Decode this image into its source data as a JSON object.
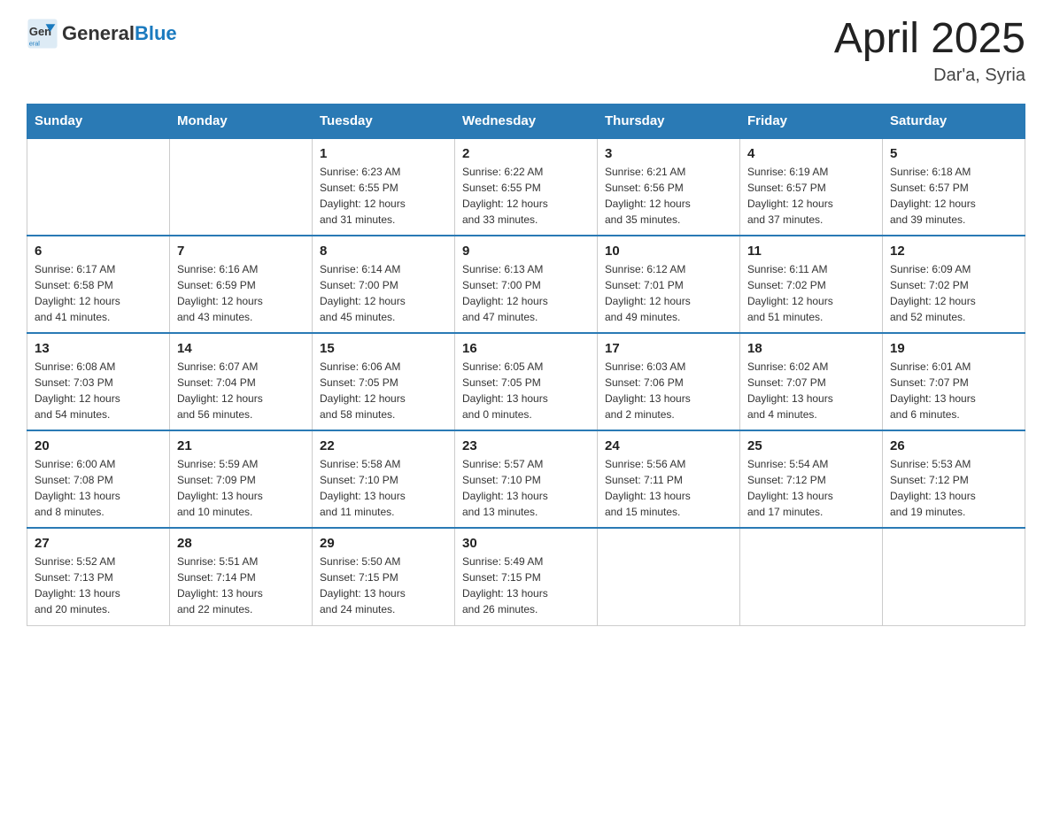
{
  "header": {
    "logo_text_general": "General",
    "logo_text_blue": "Blue",
    "month_title": "April 2025",
    "location": "Dar'a, Syria"
  },
  "days_of_week": [
    "Sunday",
    "Monday",
    "Tuesday",
    "Wednesday",
    "Thursday",
    "Friday",
    "Saturday"
  ],
  "weeks": [
    [
      {
        "day": "",
        "info": ""
      },
      {
        "day": "",
        "info": ""
      },
      {
        "day": "1",
        "info": "Sunrise: 6:23 AM\nSunset: 6:55 PM\nDaylight: 12 hours\nand 31 minutes."
      },
      {
        "day": "2",
        "info": "Sunrise: 6:22 AM\nSunset: 6:55 PM\nDaylight: 12 hours\nand 33 minutes."
      },
      {
        "day": "3",
        "info": "Sunrise: 6:21 AM\nSunset: 6:56 PM\nDaylight: 12 hours\nand 35 minutes."
      },
      {
        "day": "4",
        "info": "Sunrise: 6:19 AM\nSunset: 6:57 PM\nDaylight: 12 hours\nand 37 minutes."
      },
      {
        "day": "5",
        "info": "Sunrise: 6:18 AM\nSunset: 6:57 PM\nDaylight: 12 hours\nand 39 minutes."
      }
    ],
    [
      {
        "day": "6",
        "info": "Sunrise: 6:17 AM\nSunset: 6:58 PM\nDaylight: 12 hours\nand 41 minutes."
      },
      {
        "day": "7",
        "info": "Sunrise: 6:16 AM\nSunset: 6:59 PM\nDaylight: 12 hours\nand 43 minutes."
      },
      {
        "day": "8",
        "info": "Sunrise: 6:14 AM\nSunset: 7:00 PM\nDaylight: 12 hours\nand 45 minutes."
      },
      {
        "day": "9",
        "info": "Sunrise: 6:13 AM\nSunset: 7:00 PM\nDaylight: 12 hours\nand 47 minutes."
      },
      {
        "day": "10",
        "info": "Sunrise: 6:12 AM\nSunset: 7:01 PM\nDaylight: 12 hours\nand 49 minutes."
      },
      {
        "day": "11",
        "info": "Sunrise: 6:11 AM\nSunset: 7:02 PM\nDaylight: 12 hours\nand 51 minutes."
      },
      {
        "day": "12",
        "info": "Sunrise: 6:09 AM\nSunset: 7:02 PM\nDaylight: 12 hours\nand 52 minutes."
      }
    ],
    [
      {
        "day": "13",
        "info": "Sunrise: 6:08 AM\nSunset: 7:03 PM\nDaylight: 12 hours\nand 54 minutes."
      },
      {
        "day": "14",
        "info": "Sunrise: 6:07 AM\nSunset: 7:04 PM\nDaylight: 12 hours\nand 56 minutes."
      },
      {
        "day": "15",
        "info": "Sunrise: 6:06 AM\nSunset: 7:05 PM\nDaylight: 12 hours\nand 58 minutes."
      },
      {
        "day": "16",
        "info": "Sunrise: 6:05 AM\nSunset: 7:05 PM\nDaylight: 13 hours\nand 0 minutes."
      },
      {
        "day": "17",
        "info": "Sunrise: 6:03 AM\nSunset: 7:06 PM\nDaylight: 13 hours\nand 2 minutes."
      },
      {
        "day": "18",
        "info": "Sunrise: 6:02 AM\nSunset: 7:07 PM\nDaylight: 13 hours\nand 4 minutes."
      },
      {
        "day": "19",
        "info": "Sunrise: 6:01 AM\nSunset: 7:07 PM\nDaylight: 13 hours\nand 6 minutes."
      }
    ],
    [
      {
        "day": "20",
        "info": "Sunrise: 6:00 AM\nSunset: 7:08 PM\nDaylight: 13 hours\nand 8 minutes."
      },
      {
        "day": "21",
        "info": "Sunrise: 5:59 AM\nSunset: 7:09 PM\nDaylight: 13 hours\nand 10 minutes."
      },
      {
        "day": "22",
        "info": "Sunrise: 5:58 AM\nSunset: 7:10 PM\nDaylight: 13 hours\nand 11 minutes."
      },
      {
        "day": "23",
        "info": "Sunrise: 5:57 AM\nSunset: 7:10 PM\nDaylight: 13 hours\nand 13 minutes."
      },
      {
        "day": "24",
        "info": "Sunrise: 5:56 AM\nSunset: 7:11 PM\nDaylight: 13 hours\nand 15 minutes."
      },
      {
        "day": "25",
        "info": "Sunrise: 5:54 AM\nSunset: 7:12 PM\nDaylight: 13 hours\nand 17 minutes."
      },
      {
        "day": "26",
        "info": "Sunrise: 5:53 AM\nSunset: 7:12 PM\nDaylight: 13 hours\nand 19 minutes."
      }
    ],
    [
      {
        "day": "27",
        "info": "Sunrise: 5:52 AM\nSunset: 7:13 PM\nDaylight: 13 hours\nand 20 minutes."
      },
      {
        "day": "28",
        "info": "Sunrise: 5:51 AM\nSunset: 7:14 PM\nDaylight: 13 hours\nand 22 minutes."
      },
      {
        "day": "29",
        "info": "Sunrise: 5:50 AM\nSunset: 7:15 PM\nDaylight: 13 hours\nand 24 minutes."
      },
      {
        "day": "30",
        "info": "Sunrise: 5:49 AM\nSunset: 7:15 PM\nDaylight: 13 hours\nand 26 minutes."
      },
      {
        "day": "",
        "info": ""
      },
      {
        "day": "",
        "info": ""
      },
      {
        "day": "",
        "info": ""
      }
    ]
  ]
}
